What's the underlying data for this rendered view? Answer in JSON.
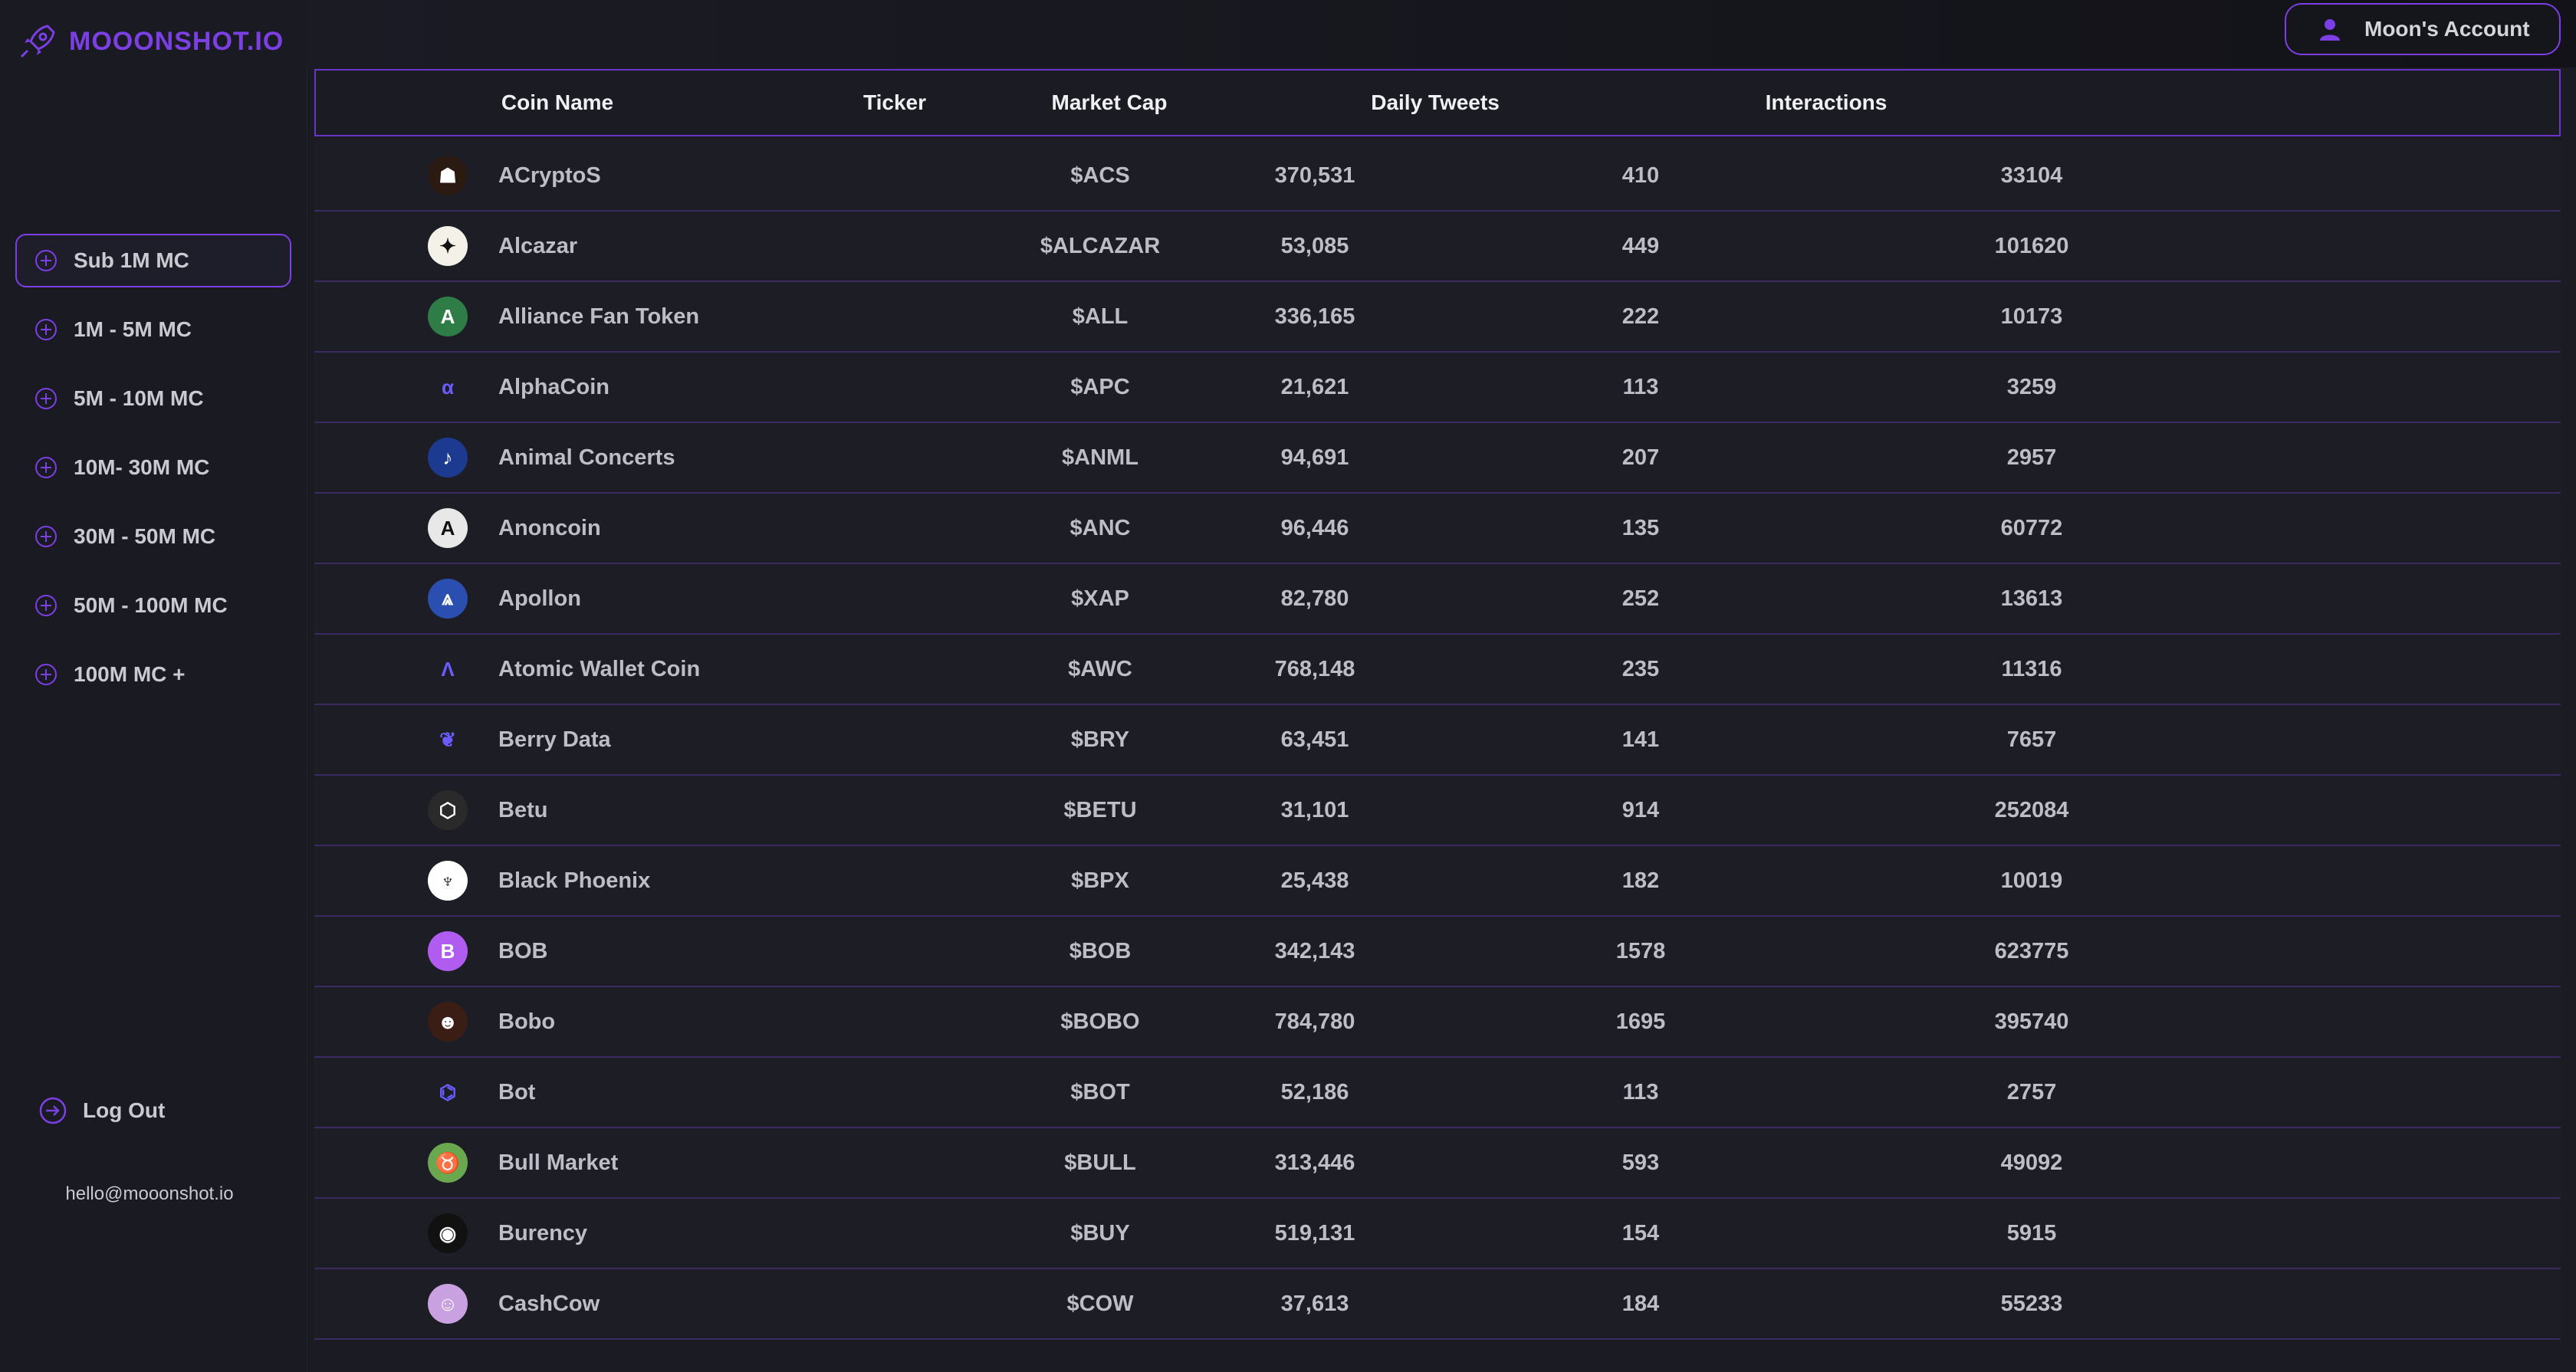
{
  "brand": {
    "name": "MOOONSHOT.IO",
    "color": "#7b3fe4"
  },
  "sidebar": {
    "items": [
      {
        "label": "Sub 1M MC",
        "active": true
      },
      {
        "label": "1M - 5M MC"
      },
      {
        "label": "5M - 10M MC"
      },
      {
        "label": "10M- 30M MC"
      },
      {
        "label": "30M - 50M MC"
      },
      {
        "label": "50M - 100M MC"
      },
      {
        "label": "100M MC +"
      }
    ],
    "logout_label": "Log Out",
    "email": "hello@mooonshot.io"
  },
  "header": {
    "account_label": "Moon's Account"
  },
  "table": {
    "columns": [
      "Coin Name",
      "Ticker",
      "Market Cap",
      "Daily Tweets",
      "Interactions"
    ],
    "rows": [
      {
        "name": "ACryptoS",
        "ticker": "$ACS",
        "market_cap": "370,531",
        "daily_tweets": "410",
        "interactions": "33104",
        "icon": "acryptos-logo-icon",
        "icon_color": "#2a1a12",
        "glyph": "☗"
      },
      {
        "name": "Alcazar",
        "ticker": "$ALCAZAR",
        "market_cap": "53,085",
        "daily_tweets": "449",
        "interactions": "101620",
        "icon": "alcazar-logo-icon",
        "icon_color": "#f4f1e8",
        "glyph": "✦"
      },
      {
        "name": "Alliance Fan Token",
        "ticker": "$ALL",
        "market_cap": "336,165",
        "daily_tweets": "222",
        "interactions": "10173",
        "icon": "alliance-logo-icon",
        "icon_color": "#2e7d46",
        "glyph": "A"
      },
      {
        "name": "AlphaCoin",
        "ticker": "$APC",
        "market_cap": "21,621",
        "daily_tweets": "113",
        "interactions": "3259",
        "icon": "alphacoin-logo-icon",
        "icon_color": "transparent",
        "glyph": "α"
      },
      {
        "name": "Animal Concerts",
        "ticker": "$ANML",
        "market_cap": "94,691",
        "daily_tweets": "207",
        "interactions": "2957",
        "icon": "animal-concerts-logo-icon",
        "icon_color": "#1c3a8f",
        "glyph": "♪"
      },
      {
        "name": "Anoncoin",
        "ticker": "$ANC",
        "market_cap": "96,446",
        "daily_tweets": "135",
        "interactions": "60772",
        "icon": "anoncoin-logo-icon",
        "icon_color": "#e8e8e8",
        "glyph": "A"
      },
      {
        "name": "Apollon",
        "ticker": "$XAP",
        "market_cap": "82,780",
        "daily_tweets": "252",
        "interactions": "13613",
        "icon": "apollon-logo-icon",
        "icon_color": "#2b4fb0",
        "glyph": "⩓"
      },
      {
        "name": "Atomic Wallet Coin",
        "ticker": "$AWC",
        "market_cap": "768,148",
        "daily_tweets": "235",
        "interactions": "11316",
        "icon": "atomic-wallet-logo-icon",
        "icon_color": "transparent",
        "glyph": "Λ"
      },
      {
        "name": "Berry Data",
        "ticker": "$BRY",
        "market_cap": "63,451",
        "daily_tweets": "141",
        "interactions": "7657",
        "icon": "berry-data-logo-icon",
        "icon_color": "transparent",
        "glyph": "❦"
      },
      {
        "name": "Betu",
        "ticker": "$BETU",
        "market_cap": "31,101",
        "daily_tweets": "914",
        "interactions": "252084",
        "icon": "betu-logo-icon",
        "icon_color": "#2a2a2a",
        "glyph": "⬡"
      },
      {
        "name": "Black Phoenix",
        "ticker": "$BPX",
        "market_cap": "25,438",
        "daily_tweets": "182",
        "interactions": "10019",
        "icon": "black-phoenix-logo-icon",
        "icon_color": "#ffffff",
        "glyph": "♆"
      },
      {
        "name": "BOB",
        "ticker": "$BOB",
        "market_cap": "342,143",
        "daily_tweets": "1578",
        "interactions": "623775",
        "icon": "bob-logo-icon",
        "icon_color": "#b05cf0",
        "glyph": "B"
      },
      {
        "name": "Bobo",
        "ticker": "$BOBO",
        "market_cap": "784,780",
        "daily_tweets": "1695",
        "interactions": "395740",
        "icon": "bobo-logo-icon",
        "icon_color": "#3a1e16",
        "glyph": "☻"
      },
      {
        "name": "Bot",
        "ticker": "$BOT",
        "market_cap": "52,186",
        "daily_tweets": "113",
        "interactions": "2757",
        "icon": "bot-logo-icon",
        "icon_color": "transparent",
        "glyph": "⌬"
      },
      {
        "name": "Bull Market",
        "ticker": "$BULL",
        "market_cap": "313,446",
        "daily_tweets": "593",
        "interactions": "49092",
        "icon": "bull-market-logo-icon",
        "icon_color": "#6aa84f",
        "glyph": "♉"
      },
      {
        "name": "Burency",
        "ticker": "$BUY",
        "market_cap": "519,131",
        "daily_tweets": "154",
        "interactions": "5915",
        "icon": "burency-logo-icon",
        "icon_color": "#111111",
        "glyph": "◉"
      },
      {
        "name": "CashCow",
        "ticker": "$COW",
        "market_cap": "37,613",
        "daily_tweets": "184",
        "interactions": "55233",
        "icon": "cashcow-logo-icon",
        "icon_color": "#c9a0e0",
        "glyph": "☺"
      }
    ]
  }
}
